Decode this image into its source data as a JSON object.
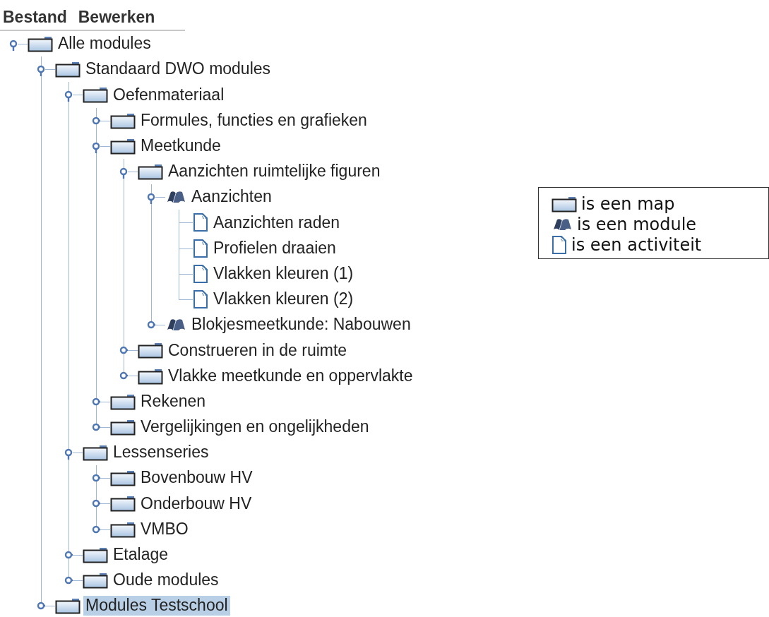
{
  "menu": [
    {
      "label": "Bestand"
    },
    {
      "label": "Bewerken"
    }
  ],
  "tree": [
    {
      "label": "Alle modules",
      "kind": "folder",
      "expanded": true,
      "selected": false,
      "children": [
        {
          "label": "Standaard DWO modules",
          "kind": "folder",
          "expanded": true,
          "selected": false,
          "children": [
            {
              "label": "Oefenmateriaal",
              "kind": "folder",
              "expanded": true,
              "selected": false,
              "children": [
                {
                  "label": "Formules, functies en grafieken",
                  "kind": "folder",
                  "expanded": false,
                  "selected": false
                },
                {
                  "label": "Meetkunde",
                  "kind": "folder",
                  "expanded": true,
                  "selected": false,
                  "children": [
                    {
                      "label": "Aanzichten ruimtelijke figuren",
                      "kind": "folder",
                      "expanded": true,
                      "selected": false,
                      "children": [
                        {
                          "label": "Aanzichten",
                          "kind": "module",
                          "expanded": true,
                          "selected": false,
                          "children": [
                            {
                              "label": "Aanzichten raden",
                              "kind": "activity",
                              "selected": false
                            },
                            {
                              "label": "Profielen draaien",
                              "kind": "activity",
                              "selected": false
                            },
                            {
                              "label": "Vlakken kleuren (1)",
                              "kind": "activity",
                              "selected": false
                            },
                            {
                              "label": "Vlakken kleuren (2)",
                              "kind": "activity",
                              "selected": false
                            }
                          ]
                        },
                        {
                          "label": "Blokjesmeetkunde: Nabouwen",
                          "kind": "module",
                          "expanded": false,
                          "selected": false
                        }
                      ]
                    },
                    {
                      "label": "Construeren in de ruimte",
                      "kind": "folder",
                      "expanded": false,
                      "selected": false
                    },
                    {
                      "label": "Vlakke meetkunde en oppervlakte",
                      "kind": "folder",
                      "expanded": false,
                      "selected": false
                    }
                  ]
                },
                {
                  "label": "Rekenen",
                  "kind": "folder",
                  "expanded": false,
                  "selected": false
                },
                {
                  "label": "Vergelijkingen en ongelijkheden",
                  "kind": "folder",
                  "expanded": false,
                  "selected": false
                }
              ]
            },
            {
              "label": "Lessenseries",
              "kind": "folder",
              "expanded": true,
              "selected": false,
              "children": [
                {
                  "label": "Bovenbouw HV",
                  "kind": "folder",
                  "expanded": false,
                  "selected": false
                },
                {
                  "label": "Onderbouw HV",
                  "kind": "folder",
                  "expanded": false,
                  "selected": false
                },
                {
                  "label": "VMBO",
                  "kind": "folder",
                  "expanded": false,
                  "selected": false
                }
              ]
            },
            {
              "label": "Etalage",
              "kind": "folder",
              "expanded": false,
              "selected": false
            },
            {
              "label": "Oude modules",
              "kind": "folder",
              "expanded": false,
              "selected": false
            }
          ]
        },
        {
          "label": "Modules Testschool",
          "kind": "folder",
          "expanded": false,
          "selected": true
        }
      ]
    }
  ],
  "legend": [
    {
      "kind": "folder",
      "label": "is een map"
    },
    {
      "kind": "module",
      "label": "is een module"
    },
    {
      "kind": "activity",
      "label": "is een activiteit"
    }
  ]
}
